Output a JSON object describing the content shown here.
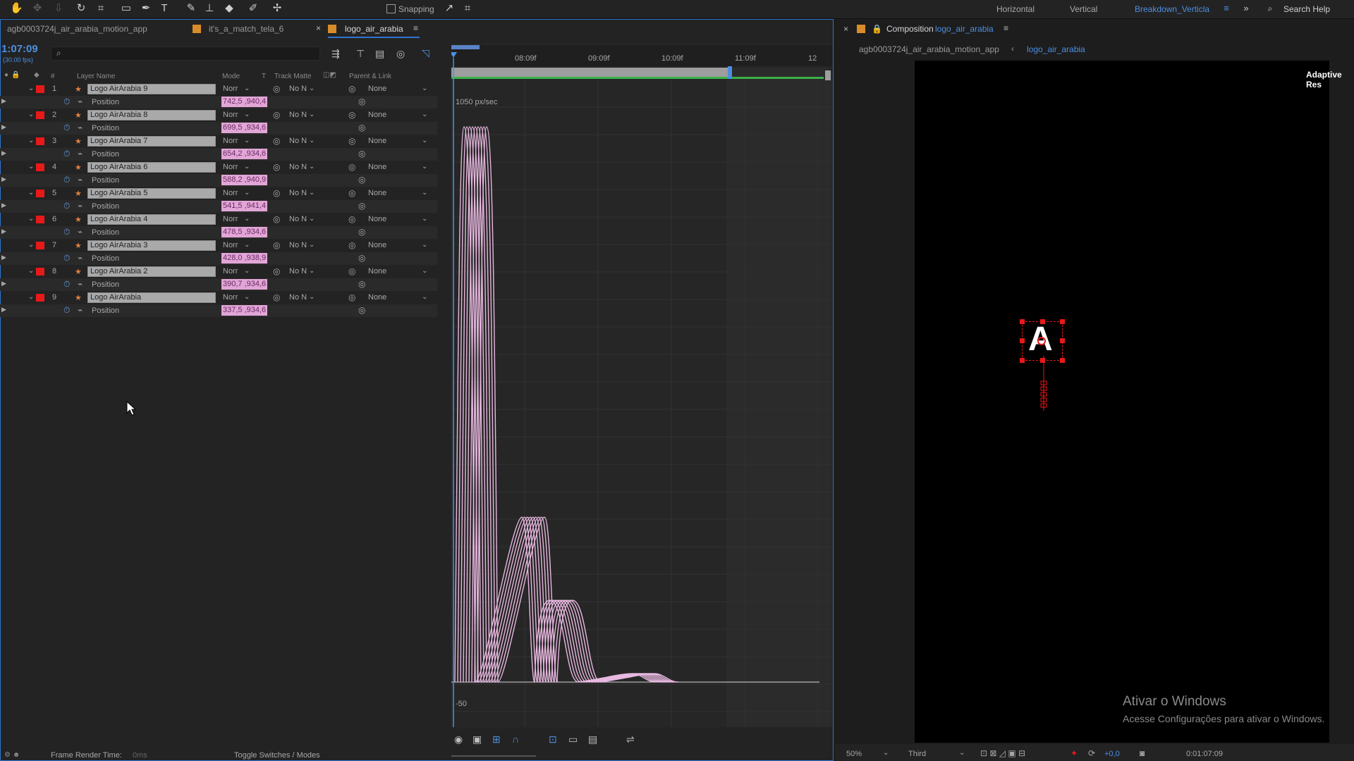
{
  "toolbar": {
    "snapping_label": "Snapping",
    "workspaces": [
      "Horizontal",
      "Vertical",
      "Breakdown_Verticla"
    ],
    "search_help": "Search Help"
  },
  "tabs": [
    "agb0003724j_air_arabia_motion_app",
    "it's_a_match_tela_6",
    "logo_air_arabia"
  ],
  "timeline": {
    "timecode": "1:07:09",
    "fps": "(30.00 fps)",
    "columns": {
      "layer_name": "Layer Name",
      "mode": "Mode",
      "t": "T",
      "track_matte": "Track Matte",
      "parent": "Parent & Link"
    },
    "ruler": [
      "08:09f",
      "09:09f",
      "10:09f",
      "11:09f",
      "12"
    ],
    "graph_unit": "1050 px/sec",
    "graph_bottom_label": "-50",
    "layers": [
      {
        "num": "1",
        "name": "Logo AirArabia 9",
        "mode": "Norr",
        "matte": "No N",
        "parent": "None",
        "prop": "Position",
        "value": "742,5 ,940,4"
      },
      {
        "num": "2",
        "name": "Logo AirArabia 8",
        "mode": "Norr",
        "matte": "No N",
        "parent": "None",
        "prop": "Position",
        "value": "699,5 ,934,6"
      },
      {
        "num": "3",
        "name": "Logo AirArabia 7",
        "mode": "Norr",
        "matte": "No N",
        "parent": "None",
        "prop": "Position",
        "value": "654,2 ,934,6"
      },
      {
        "num": "4",
        "name": "Logo AirArabia 6",
        "mode": "Norr",
        "matte": "No N",
        "parent": "None",
        "prop": "Position",
        "value": "588,2 ,940,9"
      },
      {
        "num": "5",
        "name": "Logo AirArabia 5",
        "mode": "Norr",
        "matte": "No N",
        "parent": "None",
        "prop": "Position",
        "value": "541,5 ,941,4"
      },
      {
        "num": "6",
        "name": "Logo AirArabia 4",
        "mode": "Norr",
        "matte": "No N",
        "parent": "None",
        "prop": "Position",
        "value": "478,5 ,934,6"
      },
      {
        "num": "7",
        "name": "Logo AirArabia 3",
        "mode": "Norr",
        "matte": "No N",
        "parent": "None",
        "prop": "Position",
        "value": "428,0 ,938,9"
      },
      {
        "num": "8",
        "name": "Logo AirArabia 2",
        "mode": "Norr",
        "matte": "No N",
        "parent": "None",
        "prop": "Position",
        "value": "390,7 ,934,6"
      },
      {
        "num": "9",
        "name": "Logo AirArabia",
        "mode": "Norr",
        "matte": "No N",
        "parent": "None",
        "prop": "Position",
        "value": "337,5 ,934,6"
      }
    ],
    "footer_render": "Frame Render Time:",
    "footer_render_val": "0ms",
    "footer_toggle": "Toggle Switches / Modes"
  },
  "viewer": {
    "title": "Composition",
    "comp_name": "logo_air_arabia",
    "breadcrumb_a": "agb0003724j_air_arabia_motion_app",
    "breadcrumb_b": "logo_air_arabia",
    "adaptive": "Adaptive Res",
    "zoom": "50%",
    "resolution": "Third",
    "exposure": "+0,0",
    "timecode": "0:01:07:09",
    "logo_letter": "A"
  },
  "watermark": {
    "line1": "Ativar o Windows",
    "line2": "Acesse Configurações para ativar o Windows."
  },
  "colors": {
    "label_red": "#e81919",
    "value_pink": "#e2a6d6",
    "accent_blue": "#2e74d0",
    "curve": "#e8b8e0",
    "keyframe_red": "#e81919"
  }
}
